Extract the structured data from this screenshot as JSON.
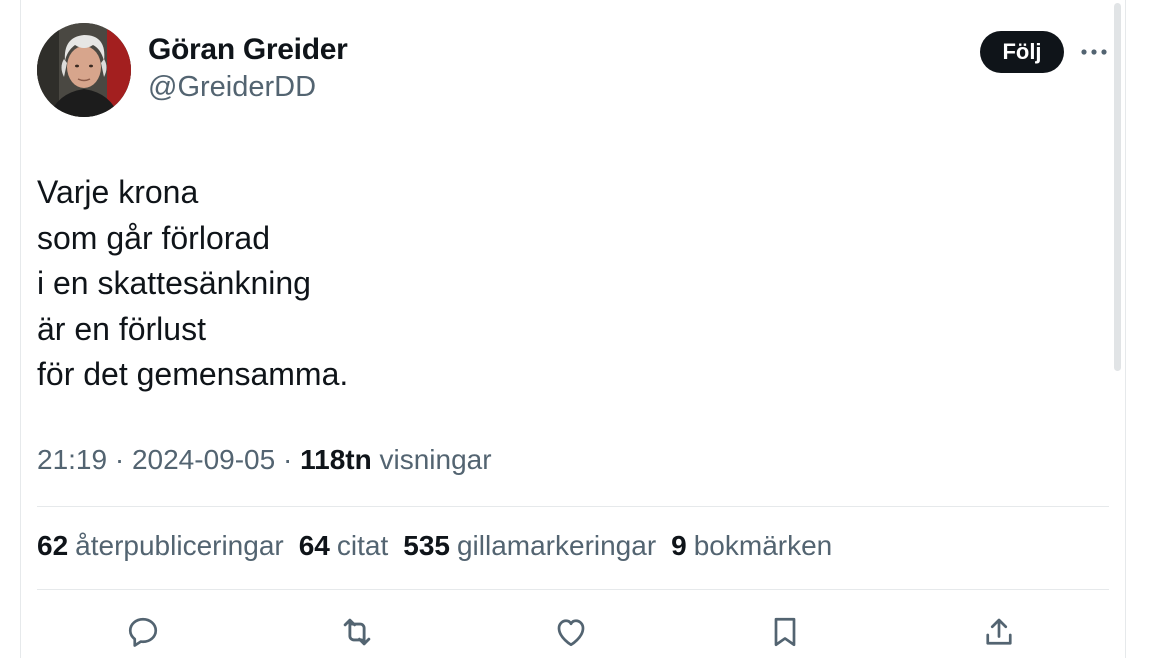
{
  "author": {
    "name": "Göran Greider",
    "handle": "@GreiderDD",
    "avatar_icon": "profile-photo"
  },
  "follow_button": {
    "label": "Följ"
  },
  "more_icon": "more-horizontal-icon",
  "tweet": {
    "lines": [
      "Varje krona",
      "som går förlorad",
      "i en skattesänkning",
      "är en förlust",
      "för det gemensamma."
    ]
  },
  "meta": {
    "time": "21:19",
    "separator": " · ",
    "date": "2024-09-05",
    "views_count": "118tn",
    "views_label": "visningar"
  },
  "stats": [
    {
      "count": "62",
      "label": "återpubliceringar"
    },
    {
      "count": "64",
      "label": "citat"
    },
    {
      "count": "535",
      "label": "gillamarkeringar"
    },
    {
      "count": "9",
      "label": "bokmärken"
    }
  ],
  "actions": [
    "reply-icon",
    "retweet-icon",
    "like-icon",
    "bookmark-icon",
    "share-icon"
  ],
  "colors": {
    "text": "#0f1419",
    "secondary": "#536471",
    "divider": "#e6e9eb",
    "button_bg": "#0f1419",
    "button_text": "#ffffff"
  }
}
